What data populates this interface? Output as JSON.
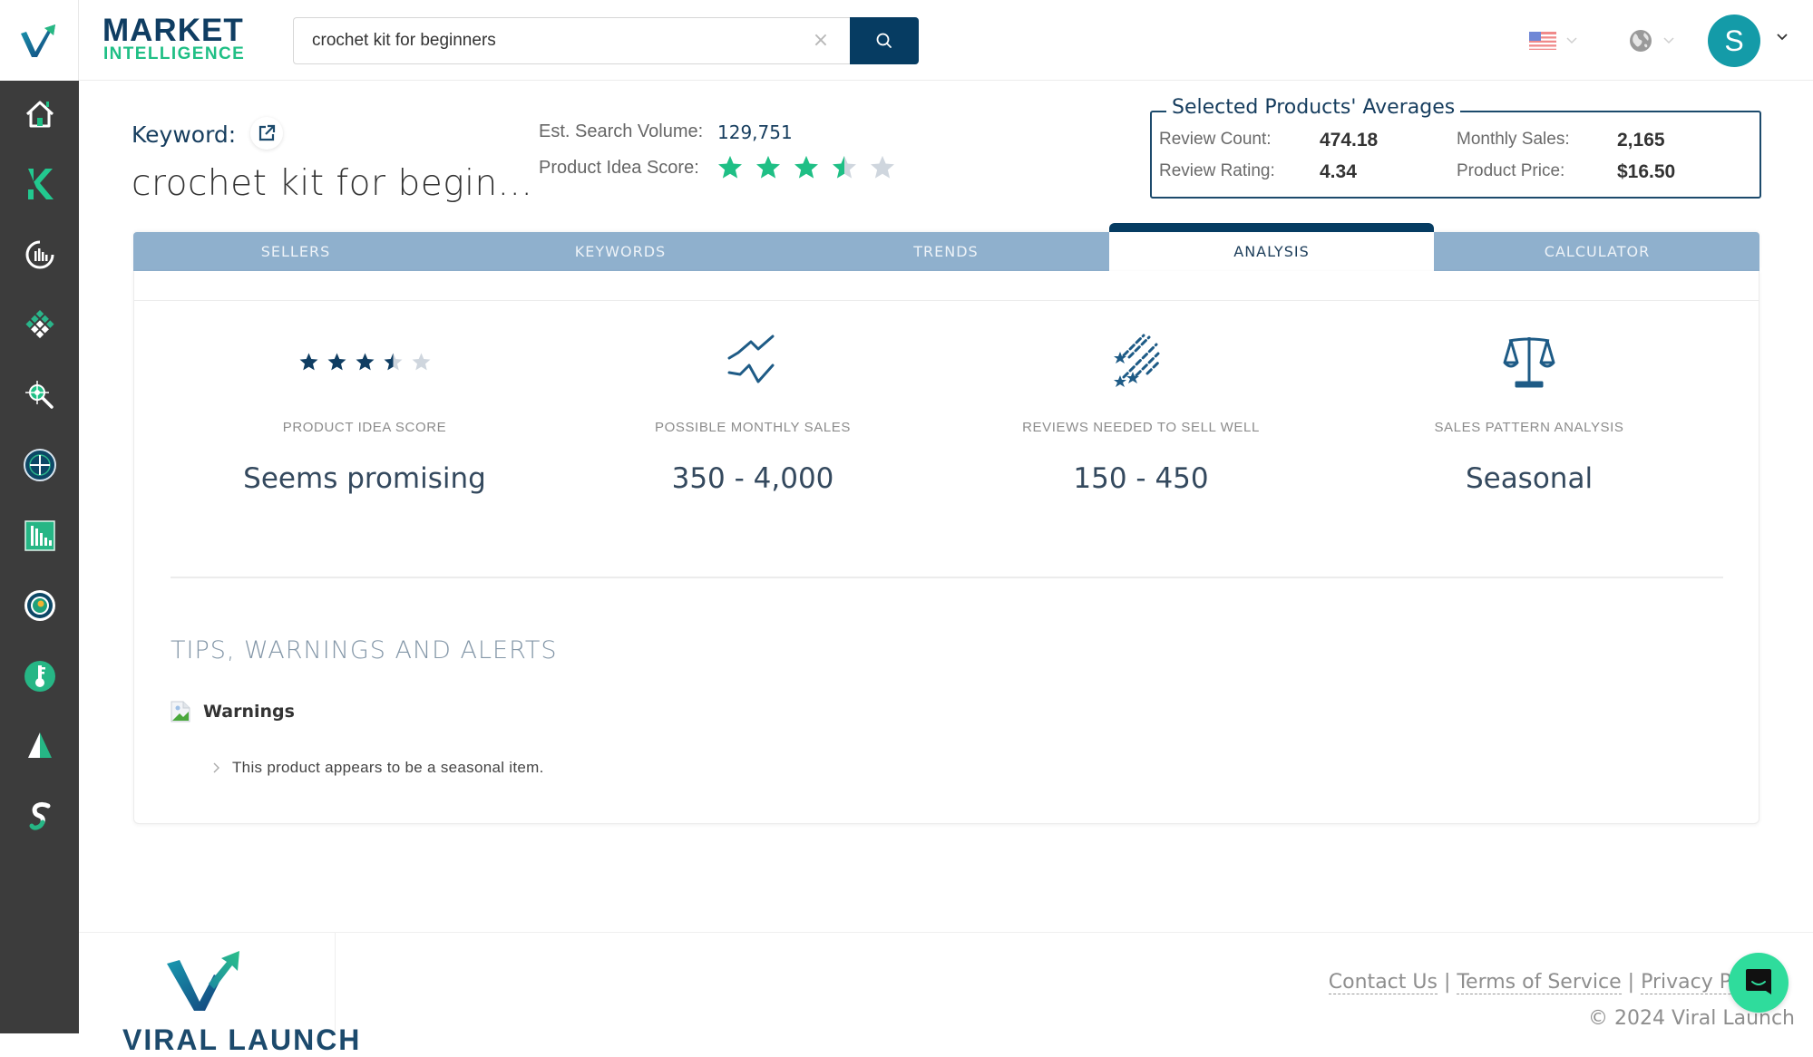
{
  "app": {
    "brand_line1": "MARKET",
    "brand_line2": "INTELLIGENCE"
  },
  "search": {
    "value": "crochet kit for beginners",
    "clear_glyph": "×"
  },
  "header": {
    "flag_icon": "us-flag-icon",
    "globe_icon": "globe-icon",
    "avatar_initial": "S"
  },
  "sidebar": {
    "items": [
      {
        "name": "home",
        "icon": "home-icon"
      },
      {
        "name": "keyword-k",
        "icon": "k-logo-icon"
      },
      {
        "name": "analytics",
        "icon": "chart-gauge-icon"
      },
      {
        "name": "categories",
        "icon": "diamond-grid-icon"
      },
      {
        "name": "product-discovery",
        "icon": "target-search-icon"
      },
      {
        "name": "tracker",
        "icon": "crosshair-icon"
      },
      {
        "name": "reports",
        "icon": "bar-chart-icon"
      },
      {
        "name": "competitor",
        "icon": "ring-icon"
      },
      {
        "name": "keyword-manager",
        "icon": "key-icon"
      },
      {
        "name": "launch",
        "icon": "sail-icon"
      },
      {
        "name": "integrations",
        "icon": "swirl-icon"
      }
    ]
  },
  "keyword": {
    "label": "Keyword:",
    "title": "crochet kit for begin...",
    "search_volume_label": "Est. Search Volume:",
    "search_volume_value": "129,751",
    "idea_score_label": "Product Idea Score:",
    "idea_score_rating": 3.5,
    "idea_score_max": 5
  },
  "averages": {
    "title": "Selected Products' Averages",
    "items": [
      {
        "label": "Review Count:",
        "value": "474.18"
      },
      {
        "label": "Monthly Sales:",
        "value": "2,165"
      },
      {
        "label": "Review Rating:",
        "value": "4.34"
      },
      {
        "label": "Product Price:",
        "value": "$16.50"
      }
    ]
  },
  "tabs": [
    {
      "label": "SELLERS",
      "active": false
    },
    {
      "label": "KEYWORDS",
      "active": false
    },
    {
      "label": "TRENDS",
      "active": false
    },
    {
      "label": "ANALYSIS",
      "active": true
    },
    {
      "label": "CALCULATOR",
      "active": false
    }
  ],
  "analysis": {
    "metrics": [
      {
        "label": "PRODUCT IDEA SCORE",
        "value": "Seems promising",
        "icon": "star-rating-icon",
        "rating": 3.5
      },
      {
        "label": "POSSIBLE MONTHLY SALES",
        "value": "350 - 4,000",
        "icon": "trend-lines-icon"
      },
      {
        "label": "REVIEWS NEEDED TO SELL WELL",
        "value": "150 - 450",
        "icon": "shooting-stars-icon"
      },
      {
        "label": "SALES PATTERN ANALYSIS",
        "value": "Seasonal",
        "icon": "balance-scale-icon"
      }
    ],
    "tips_title": "TIPS, WARNINGS AND ALERTS",
    "warnings_title": "Warnings",
    "warnings": [
      "This product appears to be a seasonal item."
    ]
  },
  "footer": {
    "logo_text": "VIRAL LAUNCH",
    "links": [
      "Contact Us",
      "Terms of Service",
      "Privacy Policy"
    ],
    "separator": " | ",
    "copyright": "© 2024 Viral Launch"
  },
  "colors": {
    "sidebar_bg": "#3c3c3c",
    "brand_navy": "#0f3d62",
    "brand_green": "#1fbf85",
    "tab_bg": "#8fb0cd",
    "tab_active_bar": "#063c62",
    "star_green": "#1fbf85",
    "star_navy": "#0f3d62",
    "star_empty": "#cfd6de",
    "avatar_bg": "#149ba8",
    "chat_bg": "#2fdc9c"
  }
}
